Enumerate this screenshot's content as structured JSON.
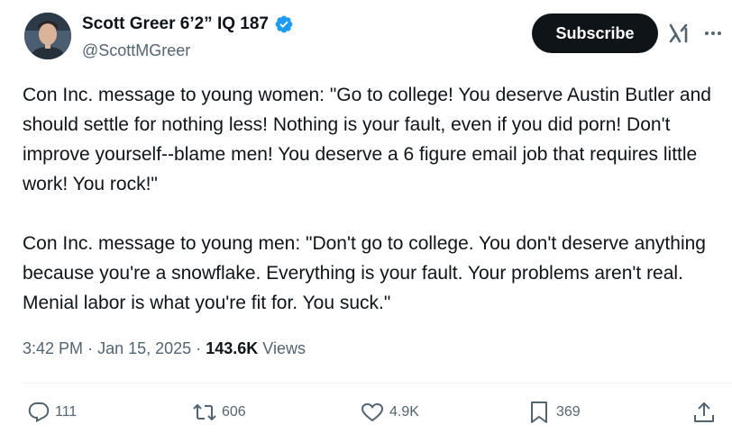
{
  "author": {
    "display_name": "Scott Greer 6’2” IQ 187",
    "handle": "@ScottMGreer",
    "verified_icon": "verified-badge-icon"
  },
  "header": {
    "subscribe_label": "Subscribe",
    "grok_icon": "grok-icon",
    "more_icon": "more-icon"
  },
  "tweet": {
    "paragraphs": [
      "Con Inc. message to young women: \"Go to college! You deserve Austin Butler and should settle for nothing less! Nothing is your fault, even if you did porn! Don't improve yourself--blame men! You deserve a 6 figure email job that requires little work! You rock!\"",
      "Con Inc. message to young men: \"Don't go to college. You don't deserve anything because you're a snowflake. Everything is your fault. Your problems aren't real. Menial labor is what you're fit for. You suck.\""
    ]
  },
  "meta": {
    "time": "3:42 PM",
    "separator": "·",
    "date": "Jan 15, 2025",
    "views_count": "143.6K",
    "views_label": "Views"
  },
  "actions": {
    "replies": "111",
    "reposts": "606",
    "likes": "4.9K",
    "bookmarks": "369"
  },
  "colors": {
    "text": "#0f1419",
    "secondary": "#536471",
    "verified": "#1d9bf0",
    "button_bg": "#0f1419"
  }
}
